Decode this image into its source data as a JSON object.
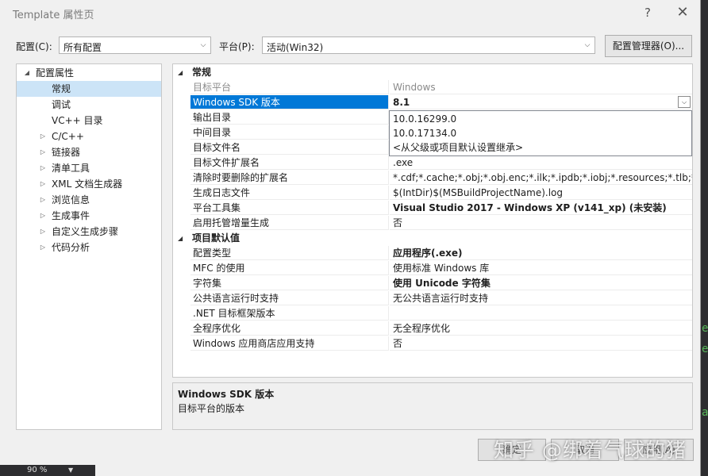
{
  "window": {
    "title": "Template 属性页",
    "help_icon": "?",
    "close_icon": "✕"
  },
  "toolbar": {
    "config_label": "配置(C):",
    "config_value": "所有配置",
    "platform_label": "平台(P):",
    "platform_value": "活动(Win32)",
    "manager_button": "配置管理器(O)..."
  },
  "tree": [
    {
      "label": "配置属性",
      "expander": "◢"
    },
    {
      "label": "常规",
      "expander": ""
    },
    {
      "label": "调试",
      "expander": ""
    },
    {
      "label": "VC++ 目录",
      "expander": ""
    },
    {
      "label": "C/C++",
      "expander": "▷"
    },
    {
      "label": "链接器",
      "expander": "▷"
    },
    {
      "label": "清单工具",
      "expander": "▷"
    },
    {
      "label": "XML 文档生成器",
      "expander": "▷"
    },
    {
      "label": "浏览信息",
      "expander": "▷"
    },
    {
      "label": "生成事件",
      "expander": "▷"
    },
    {
      "label": "自定义生成步骤",
      "expander": "▷"
    },
    {
      "label": "代码分析",
      "expander": "▷"
    }
  ],
  "grid": {
    "category_general": {
      "label": "常规",
      "expander": "◢"
    },
    "general_rows": [
      {
        "name": "目标平台",
        "value": "Windows"
      },
      {
        "name": "Windows SDK 版本",
        "value": "8.1"
      },
      {
        "name": "输出目录",
        "value": ""
      },
      {
        "name": "中间目录",
        "value": ""
      },
      {
        "name": "目标文件名",
        "value": ""
      },
      {
        "name": "目标文件扩展名",
        "value": ".exe"
      },
      {
        "name": "清除时要删除的扩展名",
        "value": "*.cdf;*.cache;*.obj;*.obj.enc;*.ilk;*.ipdb;*.iobj;*.resources;*.tlb;*.tli;*.t"
      },
      {
        "name": "生成日志文件",
        "value": "$(IntDir)$(MSBuildProjectName).log"
      },
      {
        "name": "平台工具集",
        "value": "Visual Studio 2017 - Windows XP (v141_xp) (未安装)"
      },
      {
        "name": "启用托管增量生成",
        "value": "否"
      }
    ],
    "category_defaults": {
      "label": "项目默认值",
      "expander": "◢"
    },
    "default_rows": [
      {
        "name": "配置类型",
        "value": "应用程序(.exe)"
      },
      {
        "name": "MFC 的使用",
        "value": "使用标准 Windows 库"
      },
      {
        "name": "字符集",
        "value": "使用 Unicode 字符集"
      },
      {
        "name": "公共语言运行时支持",
        "value": "无公共语言运行时支持"
      },
      {
        "name": ".NET 目标框架版本",
        "value": ""
      },
      {
        "name": "全程序优化",
        "value": "无全程序优化"
      },
      {
        "name": "Windows 应用商店应用支持",
        "value": "否"
      }
    ]
  },
  "sdk_dropdown": {
    "options": [
      "10.0.16299.0",
      "10.0.17134.0",
      "<从父级或项目默认设置继承>"
    ]
  },
  "description": {
    "title": "Windows SDK 版本",
    "text": "目标平台的版本"
  },
  "buttons": {
    "ok": "确定",
    "cancel": "取消",
    "apply": "应用(A)"
  },
  "statusbar": {
    "zoom": "90 %"
  },
  "watermark": "知乎 @绑着气球的猪",
  "editor_edge": [
    "e",
    "e",
    "a"
  ],
  "colors": {
    "selection": "#0078d7",
    "tree_selection": "#cce4f7",
    "background": "#f0f0f0"
  }
}
